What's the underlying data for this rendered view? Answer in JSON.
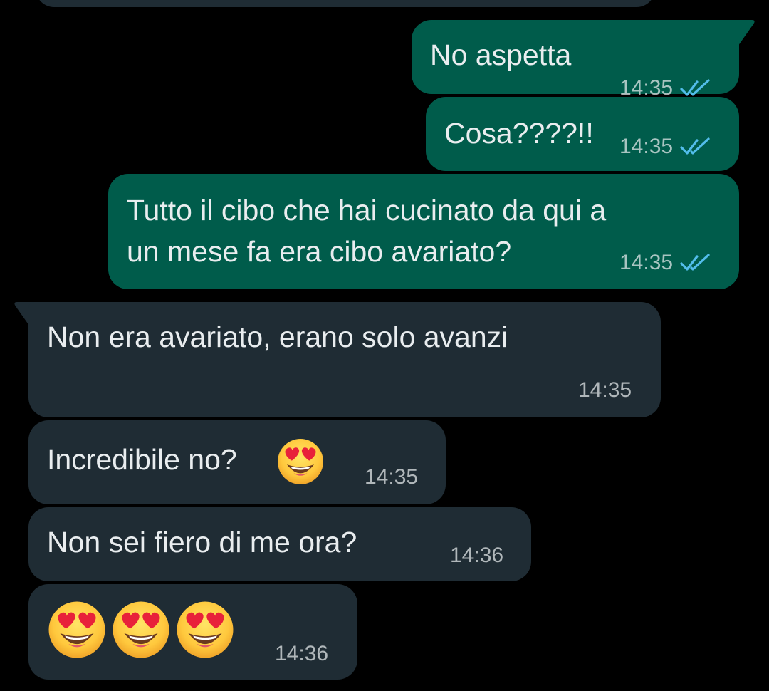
{
  "colors": {
    "background": "#000000",
    "outgoing_bubble": "#005C4B",
    "incoming_bubble": "#1F2C34",
    "text": "#E9EDEF",
    "read_ticks": "#53BDEB"
  },
  "messages": [
    {
      "direction": "outgoing",
      "text": "No aspetta",
      "time": "14:35",
      "status_icon": "double-check-read-icon"
    },
    {
      "direction": "outgoing",
      "text": "Cosa????!!",
      "time": "14:35",
      "status_icon": "double-check-read-icon"
    },
    {
      "direction": "outgoing",
      "lines": [
        "Tutto il cibo che hai cucinato da qui a",
        "un mese fa era cibo avariato?"
      ],
      "time": "14:35",
      "status_icon": "double-check-read-icon"
    },
    {
      "direction": "incoming",
      "text": "Non era avariato, erano solo avanzi",
      "time": "14:35"
    },
    {
      "direction": "incoming",
      "text": "Incredibile no?",
      "emoji": "heart-eyes-emoji",
      "time": "14:35"
    },
    {
      "direction": "incoming",
      "text": "Non sei fiero di me ora?",
      "time": "14:36"
    },
    {
      "direction": "incoming",
      "emojis": [
        "heart-eyes-emoji",
        "heart-eyes-emoji",
        "heart-eyes-emoji"
      ],
      "time": "14:36"
    }
  ]
}
